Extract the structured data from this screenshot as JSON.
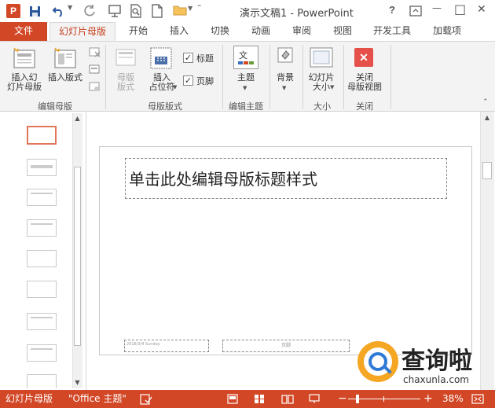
{
  "app": {
    "title": "演示文稿1 - PowerPoint",
    "logo_letter": "P",
    "help": "?",
    "minimize": "—",
    "restore": "□",
    "close": "✕"
  },
  "tabs": [
    {
      "label": "文件"
    },
    {
      "label": "幻灯片母版"
    },
    {
      "label": "开始"
    },
    {
      "label": "插入"
    },
    {
      "label": "切换"
    },
    {
      "label": "动画"
    },
    {
      "label": "审阅"
    },
    {
      "label": "视图"
    },
    {
      "label": "开发工具"
    },
    {
      "label": "加载项"
    }
  ],
  "ribbon": {
    "insert_slide_master": "插入幻\n灯片母版",
    "insert_layout": "插入版式",
    "master_layout": "母版\n版式",
    "insert_placeholder": "插入\n占位符",
    "title_check": "标题",
    "footer_check": "页脚",
    "themes": "主题",
    "background": "背景",
    "slide_size": "幻灯片\n大小",
    "close_master": "关闭\n母版视图",
    "groups": {
      "edit_master": "编辑母版",
      "master_layout": "母版版式",
      "edit_theme": "编辑主题",
      "size": "大小",
      "close": "关闭"
    }
  },
  "slide": {
    "title_placeholder": "单击此处编辑母版标题样式",
    "footer_date": "2018/3/4 Sunday",
    "footer_text": "页脚"
  },
  "status": {
    "view_name": "幻灯片母版",
    "theme_name": "\"Office 主题\"",
    "zoom": "38%"
  },
  "watermark": {
    "brand": "查询啦",
    "url": "chaxunla.com"
  },
  "colors": {
    "accent": "#d24726",
    "tab_active_text": "#c43e1c",
    "close_red": "#e5514a"
  }
}
